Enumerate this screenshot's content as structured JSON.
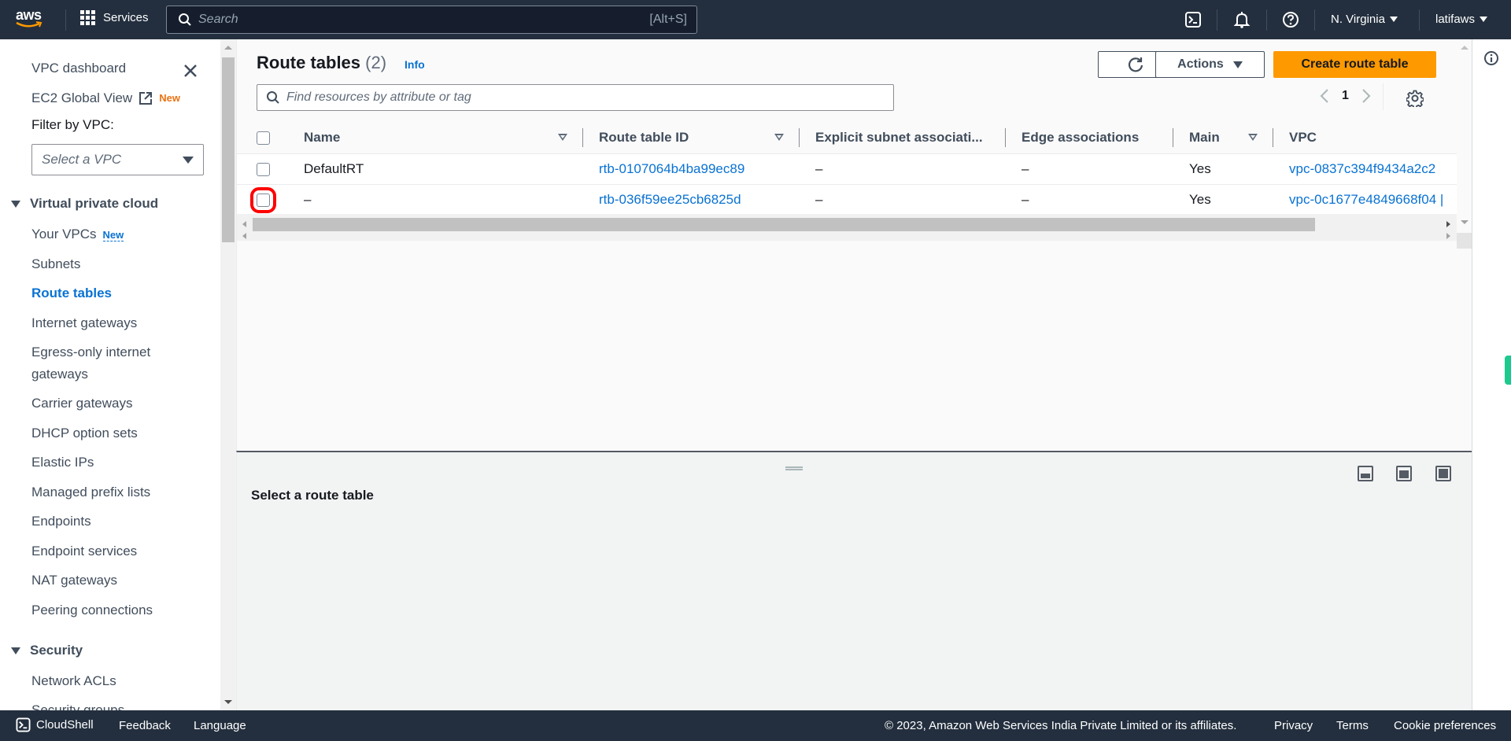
{
  "topnav": {
    "logo": "aws",
    "services_label": "Services",
    "search_placeholder": "Search",
    "search_shortcut": "[Alt+S]",
    "icons": [
      "cloudshell-icon",
      "notifications-bell-icon",
      "help-icon"
    ],
    "region": "N. Virginia",
    "account": "latifaws"
  },
  "sidebar": {
    "dashboard": "VPC dashboard",
    "ec2_global_view": "EC2 Global View",
    "ec2_badge": "New",
    "filter_label": "Filter by VPC:",
    "filter_placeholder": "Select a VPC",
    "section_vpc": "Virtual private cloud",
    "items": [
      {
        "label": "Your VPCs",
        "badge": "New"
      },
      {
        "label": "Subnets"
      },
      {
        "label": "Route tables",
        "active": true
      },
      {
        "label": "Internet gateways"
      },
      {
        "label": "Egress-only internet gateways"
      },
      {
        "label": "Carrier gateways"
      },
      {
        "label": "DHCP option sets"
      },
      {
        "label": "Elastic IPs"
      },
      {
        "label": "Managed prefix lists"
      },
      {
        "label": "Endpoints"
      },
      {
        "label": "Endpoint services"
      },
      {
        "label": "NAT gateways"
      },
      {
        "label": "Peering connections"
      }
    ],
    "section_security": "Security",
    "security_items": [
      {
        "label": "Network ACLs"
      },
      {
        "label": "Security groups"
      }
    ]
  },
  "main": {
    "title": "Route tables",
    "count": "(2)",
    "info_label": "Info",
    "find_placeholder": "Find resources by attribute or tag",
    "actions_label": "Actions",
    "create_label": "Create route table",
    "page_number": "1",
    "columns": [
      "Name",
      "Route table ID",
      "Explicit subnet associati...",
      "Edge associations",
      "Main",
      "VPC"
    ],
    "rows": [
      {
        "name": "DefaultRT",
        "route_table_id": "rtb-0107064b4ba99ec89",
        "explicit_subnet": "–",
        "edge": "–",
        "main": "Yes",
        "vpc": "vpc-0837c394f9434a2c2"
      },
      {
        "name": "–",
        "route_table_id": "rtb-036f59ee25cb6825d",
        "explicit_subnet": "–",
        "edge": "–",
        "main": "Yes",
        "vpc": "vpc-0c1677e4849668f04 |"
      }
    ]
  },
  "split_panel": {
    "title": "Select a route table"
  },
  "footer": {
    "cloudshell": "CloudShell",
    "feedback": "Feedback",
    "language": "Language",
    "copyright": "© 2023, Amazon Web Services India Private Limited or its affiliates.",
    "privacy": "Privacy",
    "terms": "Terms",
    "cookies": "Cookie preferences"
  },
  "colors": {
    "nav_bg": "#232f3e",
    "link": "#0972d3",
    "primary": "#ff9900",
    "highlight": "#ff0000"
  }
}
